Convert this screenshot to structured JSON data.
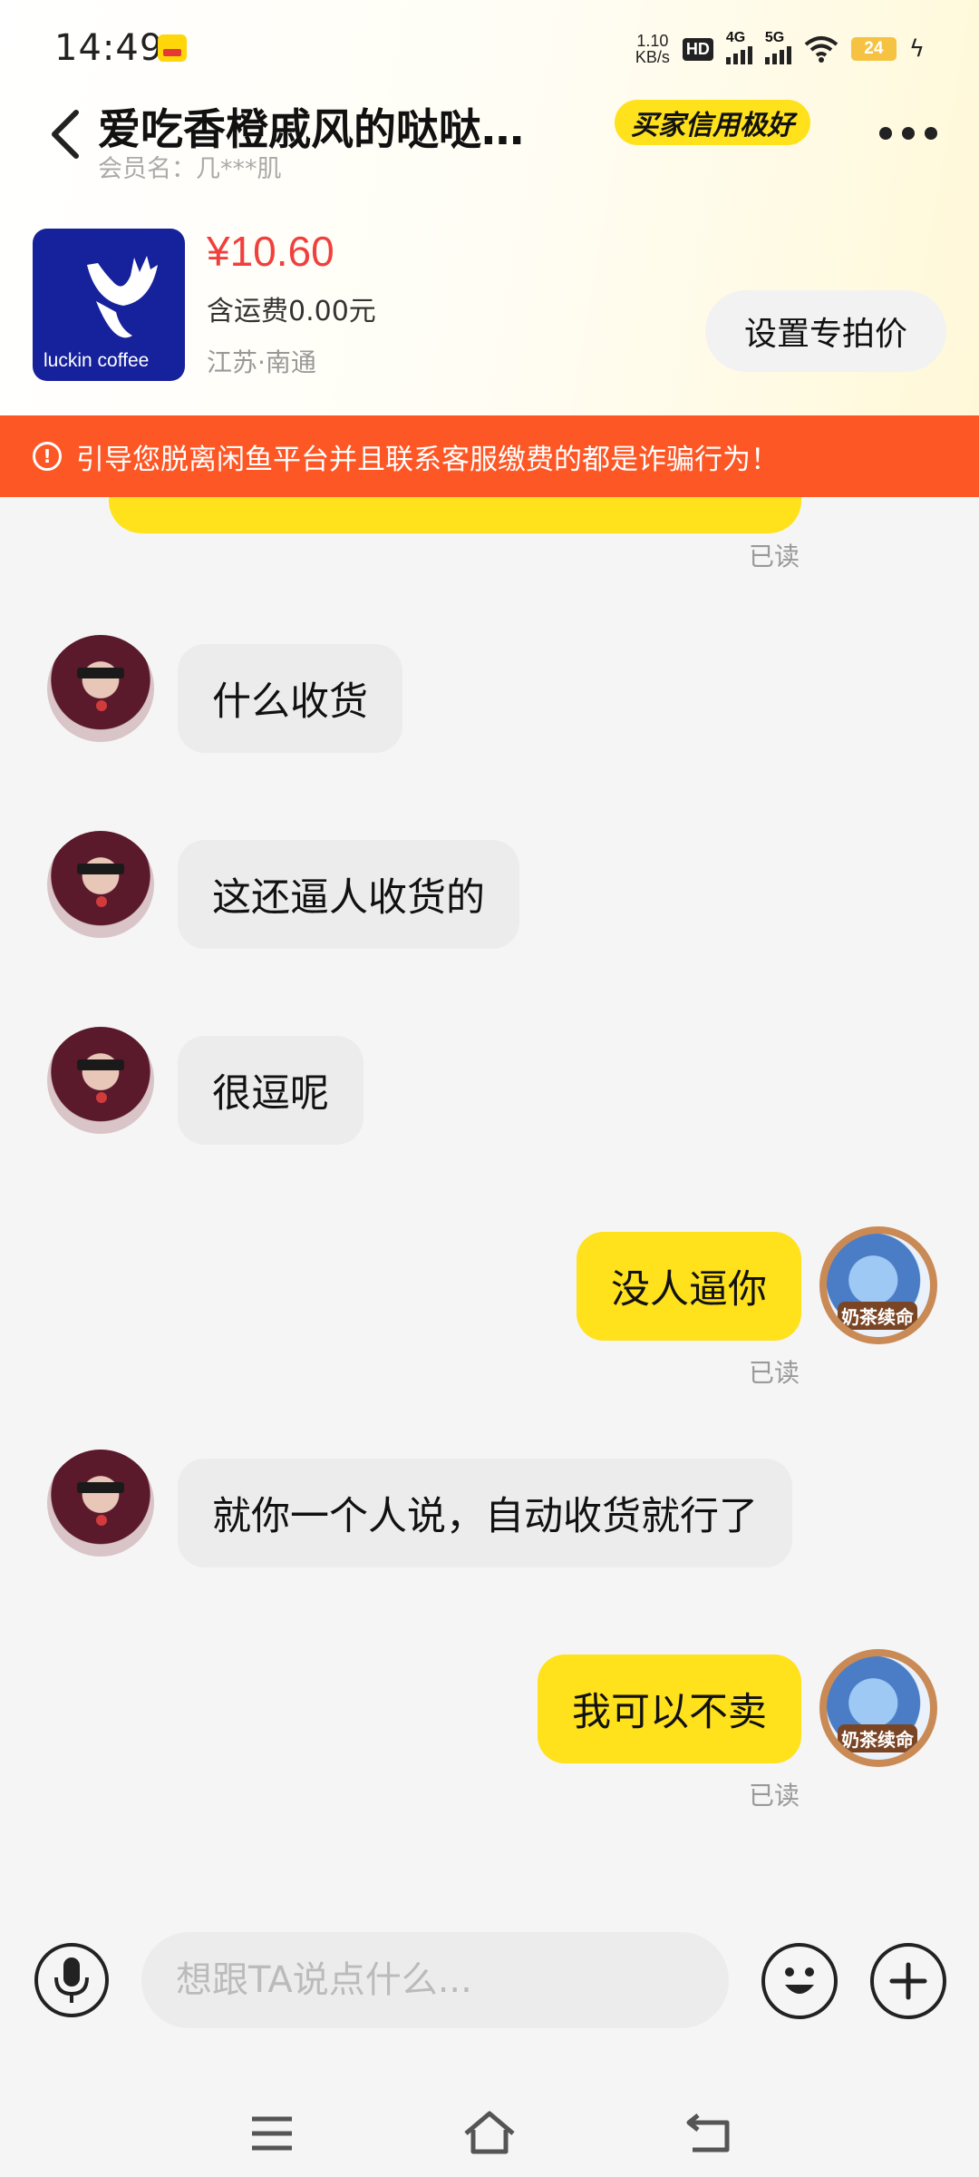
{
  "status_bar": {
    "time": "14:49",
    "net_speed_value": "1.10",
    "net_speed_unit": "KB/s",
    "hd": "HD",
    "signal_1": "4G",
    "signal_2": "5G",
    "battery": "24"
  },
  "header": {
    "title": "爱吃香橙戚风的哒哒…",
    "member_name": "会员名：几***肌",
    "credit_badge": "买家信用极好"
  },
  "product": {
    "brand": "luckin coffee",
    "price": "¥10.60",
    "shipping": "含运费0.00元",
    "location": "江苏·南通",
    "special_price_button": "设置专拍价"
  },
  "warning": {
    "text": "引导您脱离闲鱼平台并且联系客服缴费的都是诈骗行为！"
  },
  "messages": [
    {
      "direction": "in",
      "text": "什么收货"
    },
    {
      "direction": "in",
      "text": "这还逼人收货的"
    },
    {
      "direction": "in",
      "text": "很逗呢"
    },
    {
      "direction": "out",
      "text": "没人逼你",
      "receipt": "已读"
    },
    {
      "direction": "in",
      "text": "就你一个人说，自动收货就行了"
    },
    {
      "direction": "out",
      "text": "我可以不卖",
      "receipt": "已读"
    }
  ],
  "top_receipt": "已读",
  "input": {
    "placeholder": "想跟TA说点什么..."
  },
  "colors": {
    "accent_yellow": "#ffe11c",
    "warning_orange": "#fe5726",
    "price_red": "#f0403d"
  },
  "icons": [
    "back-icon",
    "more-icon",
    "warning-icon",
    "microphone-icon",
    "emoji-icon",
    "plus-icon",
    "menu-icon",
    "home-icon",
    "back-nav-icon"
  ]
}
